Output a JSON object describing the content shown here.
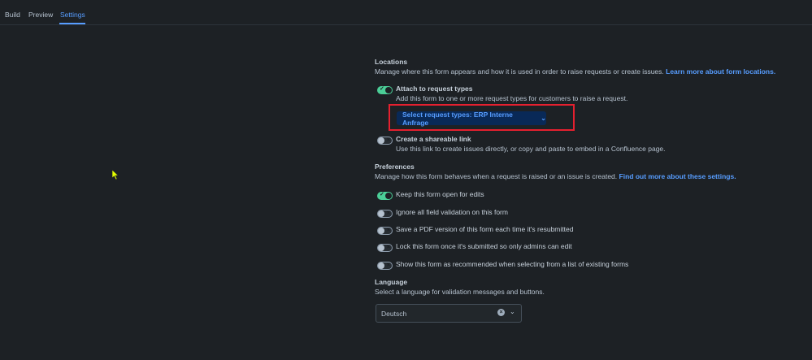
{
  "tabs": [
    {
      "label": "Build"
    },
    {
      "label": "Preview"
    },
    {
      "label": "Settings"
    }
  ],
  "locations": {
    "title": "Locations",
    "description": "Manage where this form appears and how it is used in order to raise requests or create issues.",
    "link": "Learn more about form locations.",
    "attach": {
      "label": "Attach to request types",
      "description": "Add this form to one or more request types for customers to raise a request.",
      "enabled": true
    },
    "select_button": "Select request types: ERP Interne Anfrage",
    "shareable": {
      "label": "Create a shareable link",
      "description": "Use this link to create issues directly, or copy and paste to embed in a Confluence page.",
      "enabled": false
    }
  },
  "preferences": {
    "title": "Preferences",
    "description": "Manage how this form behaves when a request is raised or an issue is created.",
    "link": "Find out more about these settings.",
    "options": [
      {
        "label": "Keep this form open for edits",
        "enabled": true
      },
      {
        "label": "Ignore all field validation on this form",
        "enabled": false
      },
      {
        "label": "Save a PDF version of this form each time it's resubmitted",
        "enabled": false
      },
      {
        "label": "Lock this form once it's submitted so only admins can edit",
        "enabled": false
      },
      {
        "label": "Show this form as recommended when selecting from a list of existing forms",
        "enabled": false
      }
    ]
  },
  "language": {
    "title": "Language",
    "description": "Select a language for validation messages and buttons.",
    "value": "Deutsch"
  },
  "colors": {
    "background": "#1d2125",
    "accent": "#579dff",
    "toggle_on": "#4bce97",
    "highlight": "#e5202f",
    "cursor": "#e5ff00"
  }
}
